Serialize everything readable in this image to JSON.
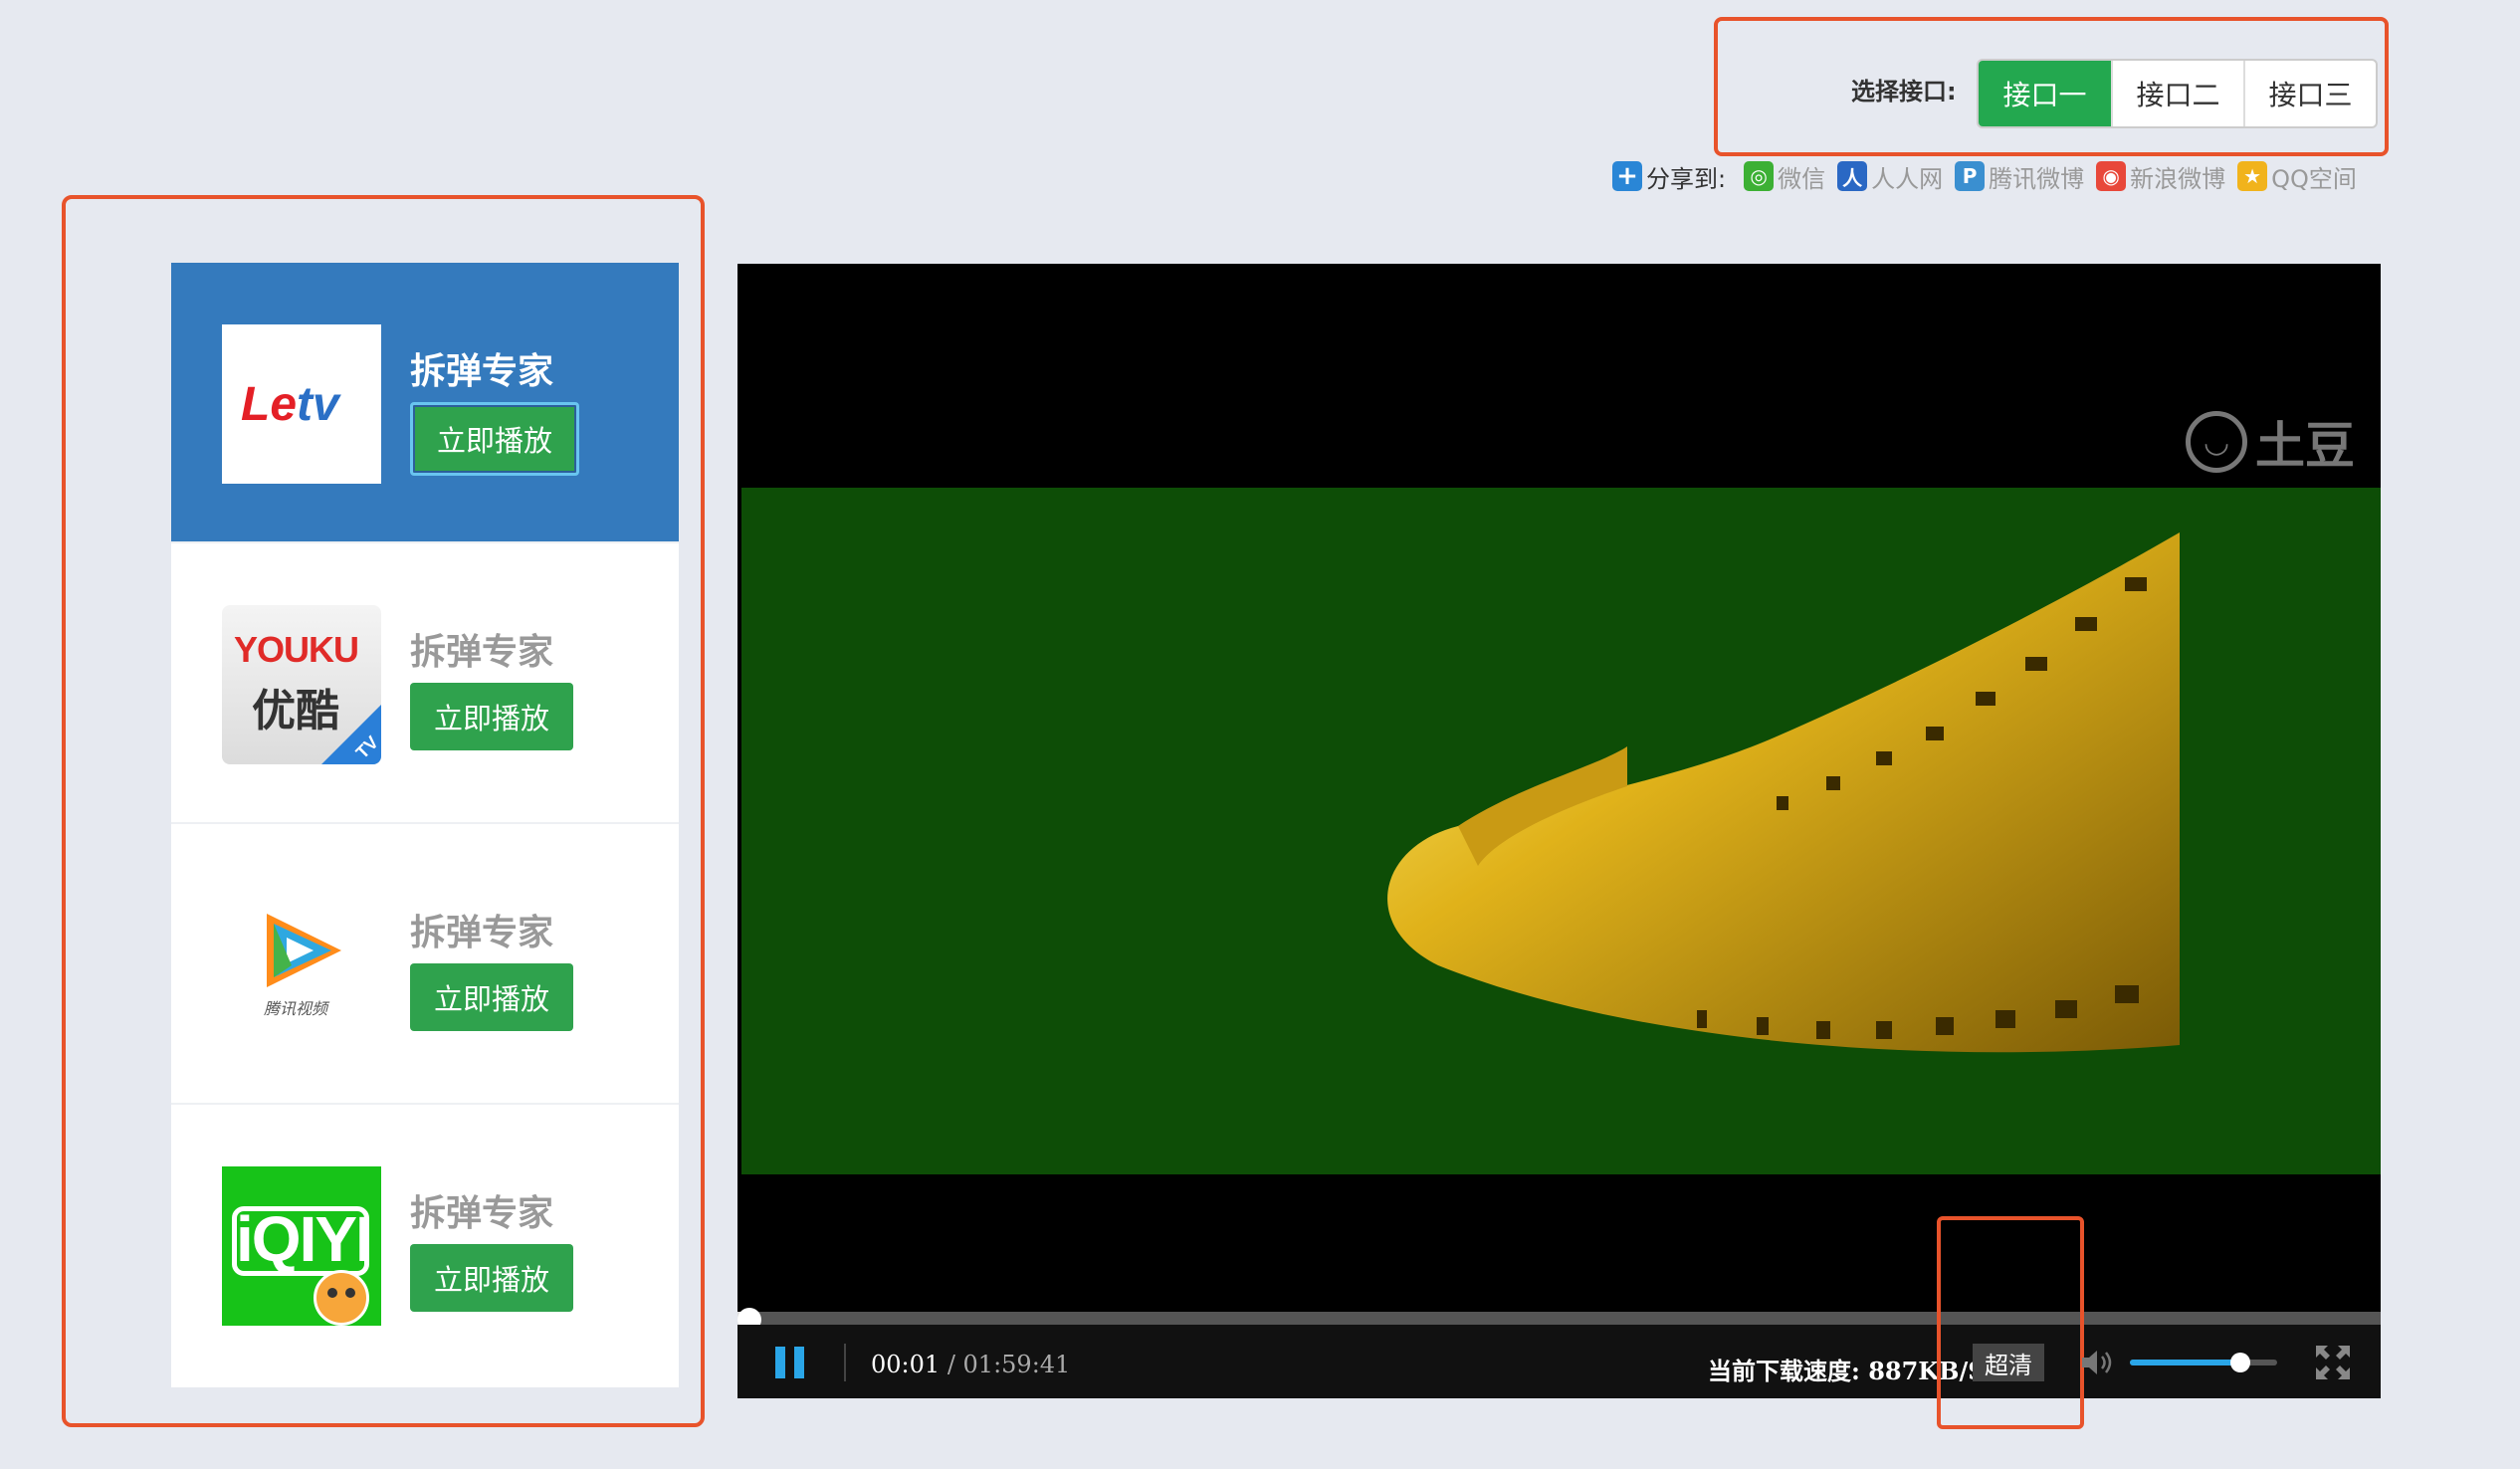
{
  "interface": {
    "label": "选择接口:",
    "options": [
      "接口一",
      "接口二",
      "接口三"
    ],
    "selected": 0
  },
  "share": {
    "label": "分享到:",
    "targets": [
      {
        "name": "微信",
        "icon": "wechat-icon",
        "color": "#3cb034"
      },
      {
        "name": "人人网",
        "icon": "renren-icon",
        "color": "#2a68c4"
      },
      {
        "name": "腾讯微博",
        "icon": "tencent-weibo-icon",
        "color": "#3a8fd0"
      },
      {
        "name": "新浪微博",
        "icon": "sina-weibo-icon",
        "color": "#e8483a"
      },
      {
        "name": "QQ空间",
        "icon": "qzone-icon",
        "color": "#f1b31c"
      }
    ]
  },
  "list": {
    "items": [
      {
        "platform": "Letv",
        "title": "拆弹专家",
        "button": "立即播放",
        "active": true
      },
      {
        "platform": "优酷",
        "brand_en": "YOUKU",
        "badge": "TV",
        "title": "拆弹专家",
        "button": "立即播放",
        "active": false
      },
      {
        "platform": "腾讯视频",
        "title": "拆弹专家",
        "button": "立即播放",
        "active": false
      },
      {
        "platform": "iQIYI",
        "title": "拆弹专家",
        "button": "立即播放",
        "active": false
      }
    ]
  },
  "player": {
    "watermark": "土豆",
    "current_time": "00:01",
    "total_time": "/ 01:59:41",
    "speed_text": "当前下载速度: 887KB/S",
    "quality": "超清",
    "progress": 0.0001,
    "volume": 0.75,
    "accent_color": "#2aa6e8"
  },
  "colors": {
    "annotation_red": "#e8532b",
    "active_green": "#23a84f",
    "active_item_blue": "#347abd"
  }
}
